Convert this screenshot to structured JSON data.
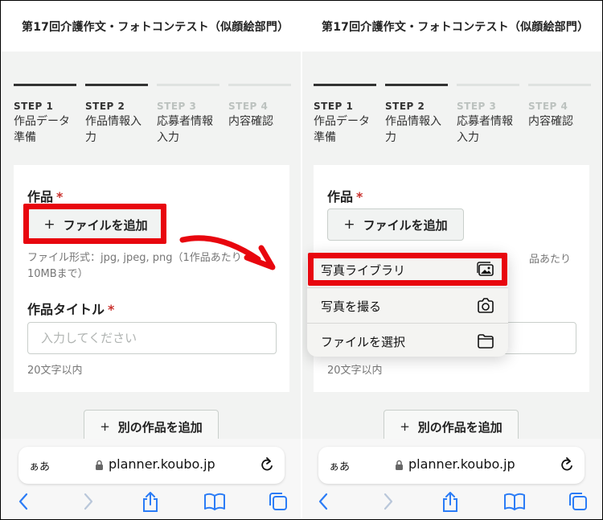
{
  "left": {
    "header_title": "第17回介護作文・フォトコンテスト（似顔絵部門）",
    "steps": [
      {
        "label": "STEP 1",
        "name_line1": "作品データ",
        "name_line2": "準備"
      },
      {
        "label": "STEP 2",
        "name_line1": "作品情報入",
        "name_line2": "力"
      },
      {
        "label": "STEP 3",
        "name_line1": "応募者情報",
        "name_line2": "入力"
      },
      {
        "label": "STEP 4",
        "name_line1": "内容確認",
        "name_line2": ""
      }
    ],
    "work_label": "作品",
    "required_mark": "*",
    "add_file_button": "ファイルを追加",
    "file_hint_line1": "ファイル形式：jpg, jpeg, png（1作品あたり",
    "file_hint_line2": "10MBまで）",
    "title_label": "作品タイトル",
    "title_placeholder": "入力してください",
    "title_hint": "20文字以内",
    "add_another_button": "別の作品を追加",
    "url_aa": "ぁあ",
    "url": "planner.koubo.jp"
  },
  "right": {
    "header_title": "第17回介護作文・フォトコンテスト（似顔絵部門）",
    "steps": [
      {
        "label": "STEP 1",
        "name_line1": "作品データ",
        "name_line2": "準備"
      },
      {
        "label": "STEP 2",
        "name_line1": "作品情報入",
        "name_line2": "力"
      },
      {
        "label": "STEP 3",
        "name_line1": "応募者情報",
        "name_line2": "入力"
      },
      {
        "label": "STEP 4",
        "name_line1": "内容確認",
        "name_line2": ""
      }
    ],
    "work_label": "作品",
    "required_mark": "*",
    "add_file_button": "ファイルを追加",
    "file_hint_partial": "品あたり",
    "title_hint": "20文字以内",
    "add_another_button": "別の作品を追加",
    "menu_items": [
      "写真ライブラリ",
      "写真を撮る",
      "ファイルを選択"
    ],
    "url_aa": "ぁあ",
    "url": "planner.koubo.jp"
  },
  "plus_glyph": "+",
  "colors": {
    "accent_red": "#e8060e",
    "step_active": "#333333",
    "step_inactive": "#bcc2bf"
  }
}
